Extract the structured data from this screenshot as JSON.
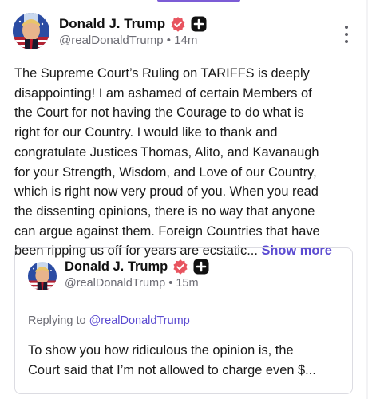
{
  "post": {
    "author": {
      "display_name": "Donald J. Trump",
      "handle": "@realDonaldTrump",
      "time": "14m",
      "separator": "•",
      "avatar_icon": "avatar-image",
      "verified_icon": "verified-badge-icon",
      "affiliation_icon": "plus-badge-icon"
    },
    "menu_icon": "more-vertical-icon",
    "body_lines": [
      "The Supreme Court’s Ruling on TARIFFS is deeply",
      "disappointing! I am ashamed of certain Members of",
      "the Court for not having the Courage to do what is",
      "right for our Country. I would like to thank and",
      "congratulate Justices Thomas, Alito, and Kavanaugh",
      "for your Strength, Wisdom, and Love of our Country,",
      "which is right now very proud of you. When you read",
      "the dissenting opinions, there is no way that anyone",
      "can argue against them. Foreign Countries that have",
      "been ripping us off for years are ecstatic..."
    ],
    "show_more_label": "Show more"
  },
  "quoted_post": {
    "author": {
      "display_name": "Donald J. Trump",
      "handle": "@realDonaldTrump",
      "time": "15m",
      "separator": "•"
    },
    "replying_to_label": "Replying to",
    "replying_to_handle": "@realDonaldTrump",
    "body_lines": [
      "To show you how ridiculous the opinion is, the",
      "Court said that I’m not allowed to charge even $..."
    ]
  },
  "colors": {
    "accent": "#5b4bd1",
    "verified_badge": "#e8545f",
    "muted_text": "#6b6b73",
    "border": "#dcdce2"
  }
}
